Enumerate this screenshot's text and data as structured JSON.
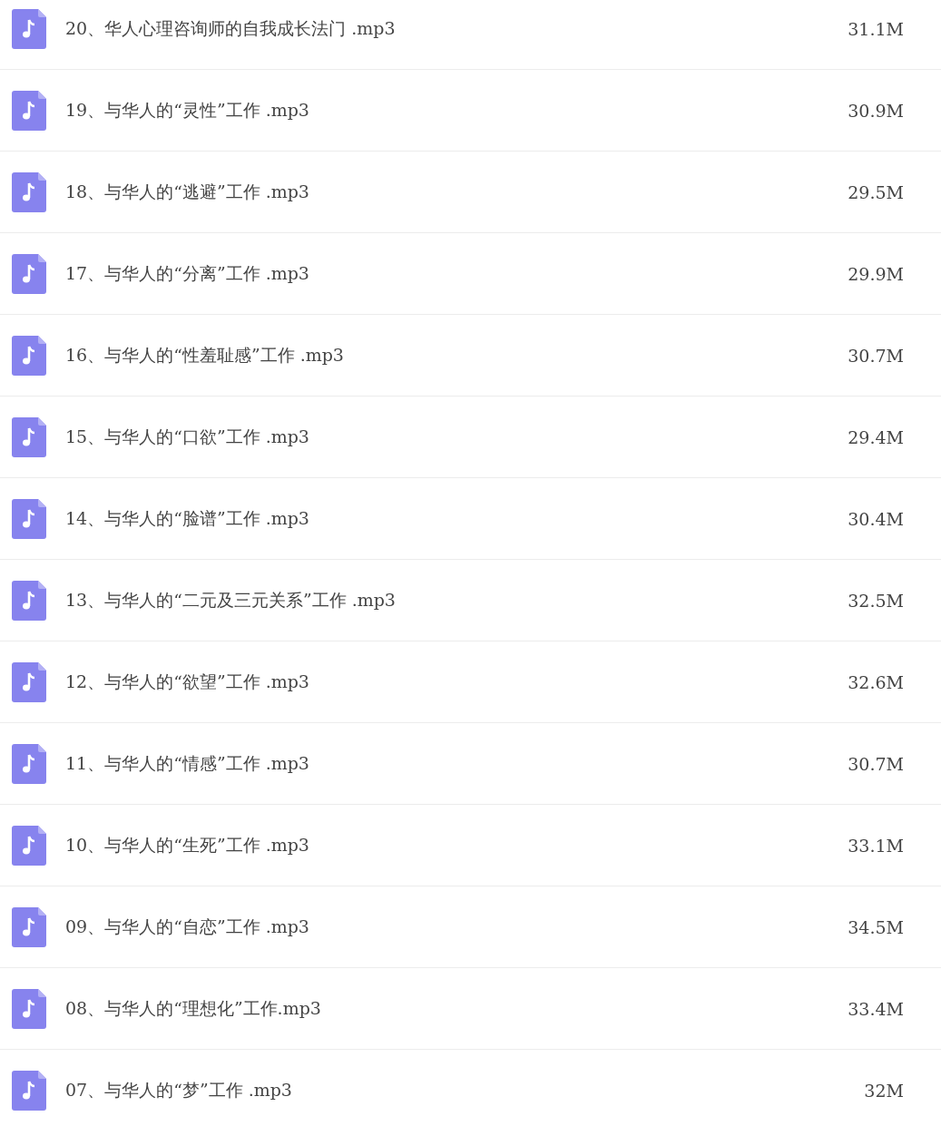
{
  "files": [
    {
      "name": "20、华人心理咨询师的自我成长法门 .mp3",
      "size": "31.1M"
    },
    {
      "name": "19、与华人的“灵性”工作 .mp3",
      "size": "30.9M"
    },
    {
      "name": "18、与华人的“逃避”工作 .mp3",
      "size": "29.5M"
    },
    {
      "name": "17、与华人的“分离”工作 .mp3",
      "size": "29.9M"
    },
    {
      "name": "16、与华人的“性羞耻感”工作 .mp3",
      "size": "30.7M"
    },
    {
      "name": "15、与华人的“口欲”工作 .mp3",
      "size": "29.4M"
    },
    {
      "name": "14、与华人的“脸谱”工作 .mp3",
      "size": "30.4M"
    },
    {
      "name": "13、与华人的“二元及三元关系”工作 .mp3",
      "size": "32.5M"
    },
    {
      "name": "12、与华人的“欲望”工作 .mp3",
      "size": "32.6M"
    },
    {
      "name": "11、与华人的“情感”工作 .mp3",
      "size": "30.7M"
    },
    {
      "name": "10、与华人的“生死”工作 .mp3",
      "size": "33.1M"
    },
    {
      "name": "09、与华人的“自恋”工作 .mp3",
      "size": "34.5M"
    },
    {
      "name": "08、与华人的“理想化”工作.mp3",
      "size": "33.4M"
    },
    {
      "name": "07、与华人的“梦”工作 .mp3",
      "size": "32M"
    }
  ]
}
